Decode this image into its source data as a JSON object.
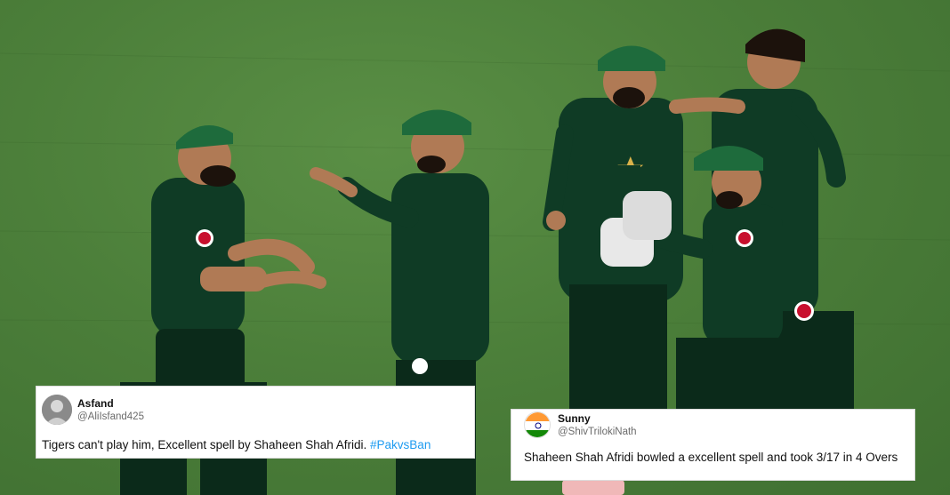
{
  "scene": {
    "description_icon": "cricket-team-celebration-photo",
    "colors": {
      "pitch": "#4c7f3a",
      "kit": "#0f3b25",
      "kit_dark": "#0b2a1a",
      "cap": "#1e6b3c",
      "star": "#d9b24a",
      "skin": "#b07a55"
    }
  },
  "tweets": [
    {
      "author_name": "Asfand",
      "author_handle": "@AliIsfand425",
      "text": "Tigers can't play him, Excellent spell by Shaheen Shah Afridi. ",
      "hashtag": "#PakvsBan",
      "avatar_icon": "profile-photo-avatar"
    },
    {
      "author_name": "Sunny",
      "author_handle": "@ShivTrilokiNath",
      "text": "Shaheen Shah Afridi bowled a excellent spell and took 3/17 in 4 Overs",
      "avatar_icon": "indian-flag-avatar"
    }
  ]
}
